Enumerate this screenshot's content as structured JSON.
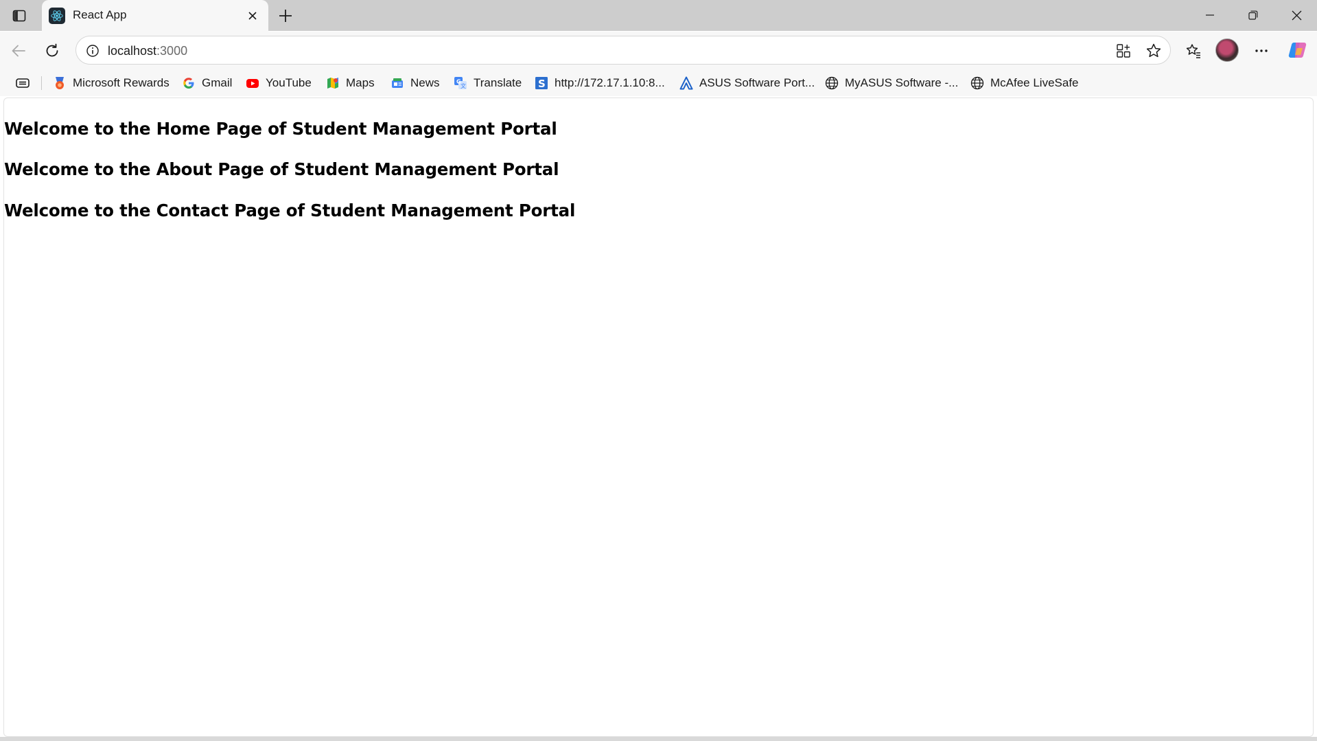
{
  "tab": {
    "title": "React App",
    "favicon": "react-icon"
  },
  "omnibox": {
    "host": "localhost",
    "port": ":3000"
  },
  "bookmarks": [
    {
      "label": "Microsoft Rewards",
      "icon": "rewards-icon"
    },
    {
      "label": "Gmail",
      "icon": "google-icon"
    },
    {
      "label": "YouTube",
      "icon": "youtube-icon"
    },
    {
      "label": "Maps",
      "icon": "maps-icon"
    },
    {
      "label": "News",
      "icon": "news-icon"
    },
    {
      "label": "Translate",
      "icon": "translate-icon"
    },
    {
      "label": "http://172.17.1.10:8...",
      "icon": "s-icon"
    },
    {
      "label": "ASUS Software Port...",
      "icon": "asus-icon"
    },
    {
      "label": "MyASUS Software -...",
      "icon": "globe-icon"
    },
    {
      "label": "McAfee LiveSafe",
      "icon": "globe-icon"
    }
  ],
  "page": {
    "headings": [
      "Welcome to the Home Page of Student Management Portal",
      "Welcome to the About Page of Student Management Portal",
      "Welcome to the Contact Page of Student Management Portal"
    ]
  },
  "colors": {
    "tabstrip": "#cdcdcd",
    "toolbar": "#f7f7f7",
    "page": "#ffffff",
    "text": "#000000"
  }
}
